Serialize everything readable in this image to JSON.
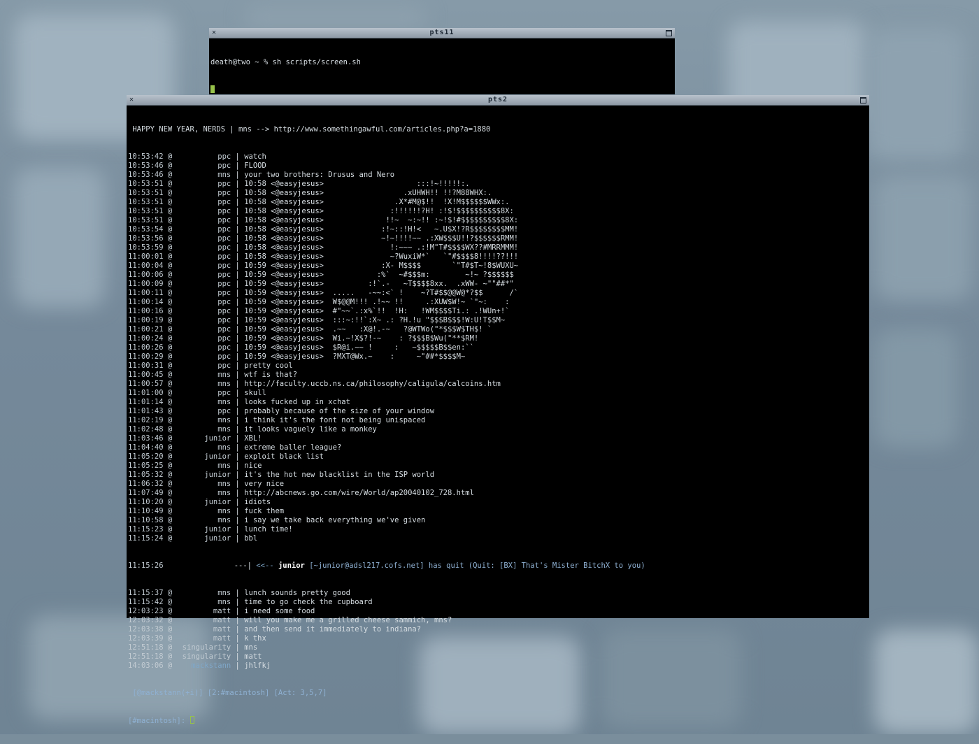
{
  "window1": {
    "title": "pts11",
    "prompt_line": "death@two ~ % sh scripts/screen.sh"
  },
  "window2": {
    "title": "pts2",
    "topic": " HAPPY NEW YEAR, NERDS | mns --> http://www.somethingawful.com/articles.php?a=1880",
    "lines": [
      {
        "ts": "10:53:42 @",
        "nick": "ppc",
        "msg": "watch"
      },
      {
        "ts": "10:53:46 @",
        "nick": "ppc",
        "msg": "FLOOD"
      },
      {
        "ts": "10:53:46 @",
        "nick": "mns",
        "msg": "your two brothers: Drusus and Nero"
      },
      {
        "ts": "10:53:51 @",
        "nick": "ppc",
        "msg": "10:58 <@easyjesus>                     :::!~!!!!!:."
      },
      {
        "ts": "10:53:51 @",
        "nick": "ppc",
        "msg": "10:58 <@easyjesus>                  .xUHWH!! !!?M88WHX:."
      },
      {
        "ts": "10:53:51 @",
        "nick": "ppc",
        "msg": "10:58 <@easyjesus>                .X*#M@$!!  !X!M$$$$$$WWx:."
      },
      {
        "ts": "10:53:51 @",
        "nick": "ppc",
        "msg": "10:58 <@easyjesus>               :!!!!!!?H! :!$!$$$$$$$$$$8X:"
      },
      {
        "ts": "10:53:51 @",
        "nick": "ppc",
        "msg": "10:58 <@easyjesus>              !!~  ~:~!! :~!$!#$$$$$$$$$$8X:"
      },
      {
        "ts": "10:53:54 @",
        "nick": "ppc",
        "msg": "10:58 <@easyjesus>             :!~::!H!<   ~.U$X!?R$$$$$$$$MM!"
      },
      {
        "ts": "10:53:56 @",
        "nick": "ppc",
        "msg": "10:58 <@easyjesus>             ~!~!!!!~~ .:XW$$$U!!?$$$$$$RMM!"
      },
      {
        "ts": "10:53:59 @",
        "nick": "ppc",
        "msg": "10:58 <@easyjesus>               !:~~~ .:!M\"T#$$$$WX??#MRRMMM!"
      },
      {
        "ts": "11:00:01 @",
        "nick": "ppc",
        "msg": "10:58 <@easyjesus>               ~?WuxiW*`   `\"#$$$$8!!!!??!!!"
      },
      {
        "ts": "11:00:04 @",
        "nick": "ppc",
        "msg": "10:59 <@easyjesus>             :X- M$$$$       `\"T#$T~!8$WUXU~"
      },
      {
        "ts": "11:00:06 @",
        "nick": "ppc",
        "msg": "10:59 <@easyjesus>            :%`  ~#$$$m:        ~!~ ?$$$$$$"
      },
      {
        "ts": "11:00:09 @",
        "nick": "ppc",
        "msg": "10:59 <@easyjesus>          :!`.-   ~T$$$$8xx.  .xWW- ~\"\"##*\""
      },
      {
        "ts": "11:00:11 @",
        "nick": "ppc",
        "msg": "10:59 <@easyjesus>  .....   -~~:<` !    ~?T#$$@@W@*?$$      /`"
      },
      {
        "ts": "11:00:14 @",
        "nick": "ppc",
        "msg": "10:59 <@easyjesus>  W$@@M!!! .!~~ !!     .:XUW$W!~ `\"~:    :"
      },
      {
        "ts": "11:00:16 @",
        "nick": "ppc",
        "msg": "10:59 <@easyjesus>  #\"~~`.:x%`!!  !H:   !WM$$$$Ti.: .!WUn+!`"
      },
      {
        "ts": "11:00:19 @",
        "nick": "ppc",
        "msg": "10:59 <@easyjesus>  :::~:!!`:X~ .: ?H.!u \"$$$B$$$!W:U!T$$M~"
      },
      {
        "ts": "11:00:21 @",
        "nick": "ppc",
        "msg": "10:59 <@easyjesus>  .~~   :X@!.-~   ?@WTWo(\"*$$$W$TH$! `"
      },
      {
        "ts": "11:00:24 @",
        "nick": "ppc",
        "msg": "10:59 <@easyjesus>  Wi.~!X$?!-~    : ?$$$B$Wu(\"**$RM!"
      },
      {
        "ts": "11:00:26 @",
        "nick": "ppc",
        "msg": "10:59 <@easyjesus>  $R@i.~~ !     :   ~$$$$$B$$en:``"
      },
      {
        "ts": "11:00:29 @",
        "nick": "ppc",
        "msg": "10:59 <@easyjesus>  ?MXT@Wx.~    :     ~\"##*$$$$M~"
      },
      {
        "ts": "11:00:31 @",
        "nick": "ppc",
        "msg": "pretty cool"
      },
      {
        "ts": "11:00:45 @",
        "nick": "mns",
        "msg": "wtf is that?"
      },
      {
        "ts": "11:00:57 @",
        "nick": "mns",
        "msg": "http://faculty.uccb.ns.ca/philosophy/caligula/calcoins.htm"
      },
      {
        "ts": "11:01:00 @",
        "nick": "ppc",
        "msg": "skull"
      },
      {
        "ts": "11:01:14 @",
        "nick": "mns",
        "msg": "looks fucked up in xchat"
      },
      {
        "ts": "11:01:43 @",
        "nick": "ppc",
        "msg": "probably because of the size of your window"
      },
      {
        "ts": "11:02:19 @",
        "nick": "mns",
        "msg": "i think it's the font not being unispaced"
      },
      {
        "ts": "11:02:48 @",
        "nick": "mns",
        "msg": "it looks vaguely like a monkey"
      },
      {
        "ts": "11:03:46 @",
        "nick": "junior",
        "msg": "XBL!"
      },
      {
        "ts": "11:04:40 @",
        "nick": "mns",
        "msg": "extreme baller league?"
      },
      {
        "ts": "11:05:20 @",
        "nick": "junior",
        "msg": "exploit black list"
      },
      {
        "ts": "11:05:25 @",
        "nick": "mns",
        "msg": "nice"
      },
      {
        "ts": "11:05:32 @",
        "nick": "junior",
        "msg": "it's the hot new blacklist in the ISP world"
      },
      {
        "ts": "11:06:32 @",
        "nick": "mns",
        "msg": "very nice"
      },
      {
        "ts": "11:07:49 @",
        "nick": "mns",
        "msg": "http://abcnews.go.com/wire/World/ap20040102_728.html"
      },
      {
        "ts": "11:10:20 @",
        "nick": "junior",
        "msg": "idiots"
      },
      {
        "ts": "11:10:49 @",
        "nick": "mns",
        "msg": "fuck them"
      },
      {
        "ts": "11:10:58 @",
        "nick": "mns",
        "msg": "i say we take back everything we've given"
      },
      {
        "ts": "11:15:23 @",
        "nick": "junior",
        "msg": "lunch time!"
      },
      {
        "ts": "11:15:24 @",
        "nick": "junior",
        "msg": "bbl"
      }
    ],
    "quit_line": {
      "ts": "11:15:26",
      "prefix": "                ---| ",
      "arrow": "<<-- ",
      "nick": "junior",
      "host": " [~junior@adsl217.cofs.net]",
      "text": " has quit (Quit: [BX] That's Mister BitchX to you)"
    },
    "lines_after": [
      {
        "ts": "11:15:37 @",
        "nick": "mns",
        "msg": "lunch sounds pretty good"
      },
      {
        "ts": "11:15:42 @",
        "nick": "mns",
        "msg": "time to go check the cupboard"
      },
      {
        "ts": "12:03:23 @",
        "nick": "matt",
        "msg": "i need some food"
      },
      {
        "ts": "12:03:32 @",
        "nick": "matt",
        "msg": "will you make me a grilled cheese sammich, mns?"
      },
      {
        "ts": "12:03:38 @",
        "nick": "matt",
        "msg": "and then send it immediately to indiana?"
      },
      {
        "ts": "12:03:39 @",
        "nick": "matt",
        "msg": "k thx"
      },
      {
        "ts": "12:51:18 @",
        "nick": "singularity",
        "msg": "mns"
      },
      {
        "ts": "12:51:18 @",
        "nick": "singularity",
        "msg": "matt"
      },
      {
        "ts": "14:03:06 @",
        "nick": "mackstann",
        "msg": "jhlfkj",
        "self": true
      }
    ],
    "status_bar": " [@mackstann(+i)] [2:#macintosh] [Act: 3,5,7]",
    "input_prompt": "[#macintosh]: "
  },
  "colors": {
    "accent_blue": "#7fa7c9",
    "cursor_green": "#97c24a",
    "terminal_bg": "#000000",
    "terminal_fg": "#d6dde2"
  }
}
